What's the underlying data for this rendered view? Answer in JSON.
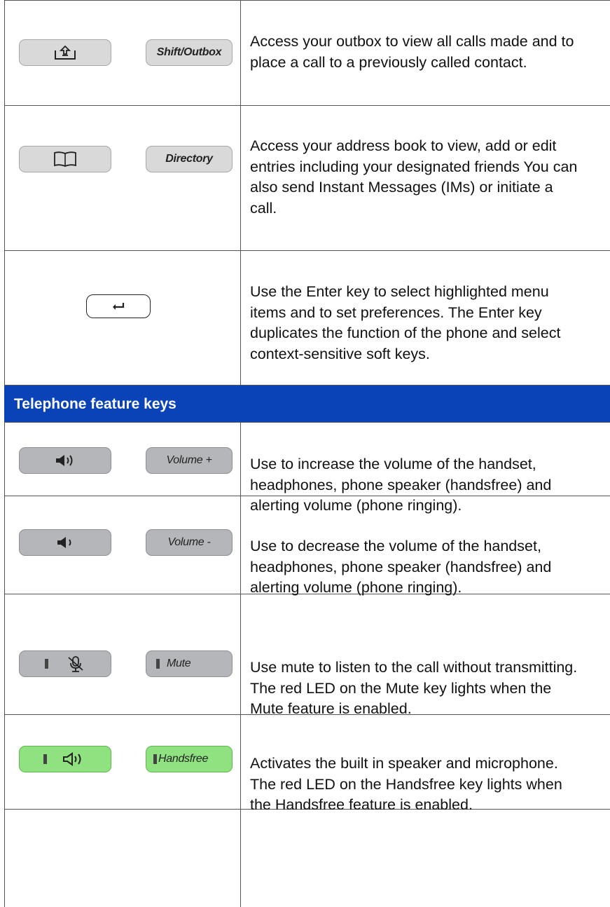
{
  "rows": [
    {
      "key_label": "Shift/Outbox",
      "icon": "outbox-icon",
      "description": "Access your outbox to view all calls made and to place a call to a previously called contact."
    },
    {
      "key_label": "Directory",
      "icon": "book-icon",
      "description": "Access your address book to view, add or edit entries including your designated friends You can also send Instant Messages (IMs) or initiate a call."
    },
    {
      "key_label": "",
      "icon": "enter-icon",
      "description": "Use the Enter key to select highlighted menu items and to set preferences. The Enter key duplicates the function of the phone and select context-sensitive soft keys."
    }
  ],
  "section": {
    "title": "Telephone feature keys",
    "color": "#0a43b8"
  },
  "feature_rows": [
    {
      "key_label": "Volume +",
      "icon": "volume-up-icon",
      "description": "Use to increase the volume of the handset, headphones, phone speaker (handsfree) and alerting volume (phone ringing)."
    },
    {
      "key_label": "Volume -",
      "icon": "volume-down-icon",
      "description": "Use to decrease the volume of the handset, headphones, phone speaker (handsfree) and alerting volume (phone ringing)."
    },
    {
      "key_label": "Mute",
      "icon": "mute-mic-icon",
      "description": "Use mute to listen to the call without transmitting. The red LED on the Mute key lights when the Mute feature is enabled."
    },
    {
      "key_label": "Handsfree",
      "icon": "speaker-icon",
      "description": "Activates the built in speaker and microphone. The red LED on the Handsfree key lights when the Handsfree feature is enabled.",
      "key_color": "#8fe27f"
    }
  ]
}
